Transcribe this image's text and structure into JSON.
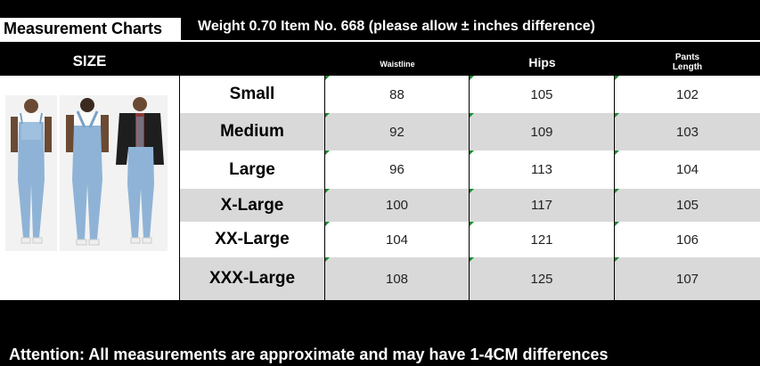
{
  "header": {
    "title": "Measurement Charts",
    "subtitle": "Weight 0.70 Item No. 668 (please allow ± inches difference)"
  },
  "columns": {
    "size": "SIZE",
    "waistline": "Waistline",
    "hips": "Hips",
    "pants_length_line1": "Pants",
    "pants_length_line2": "Length"
  },
  "rows": [
    {
      "size": "Small",
      "waistline": "88",
      "hips": "105",
      "pants_length": "102"
    },
    {
      "size": "Medium",
      "waistline": "92",
      "hips": "109",
      "pants_length": "103"
    },
    {
      "size": "Large",
      "waistline": "96",
      "hips": "113",
      "pants_length": "104"
    },
    {
      "size": "X-Large",
      "waistline": "100",
      "hips": "117",
      "pants_length": "105"
    },
    {
      "size": "XX-Large",
      "waistline": "104",
      "hips": "121",
      "pants_length": "106"
    },
    {
      "size": "XXX-Large",
      "waistline": "108",
      "hips": "125",
      "pants_length": "107"
    }
  ],
  "footer": {
    "attention": "Attention: All measurements are approximate and may have 1-4CM differences"
  },
  "colors": {
    "background": "#000000",
    "row_white": "#ffffff",
    "row_grey": "#d9d9d9",
    "denim": "#8fb3d6",
    "tick": "#1a8a2e"
  },
  "product_photos": [
    "front-view",
    "back-view",
    "styled-view-with-blazer"
  ]
}
